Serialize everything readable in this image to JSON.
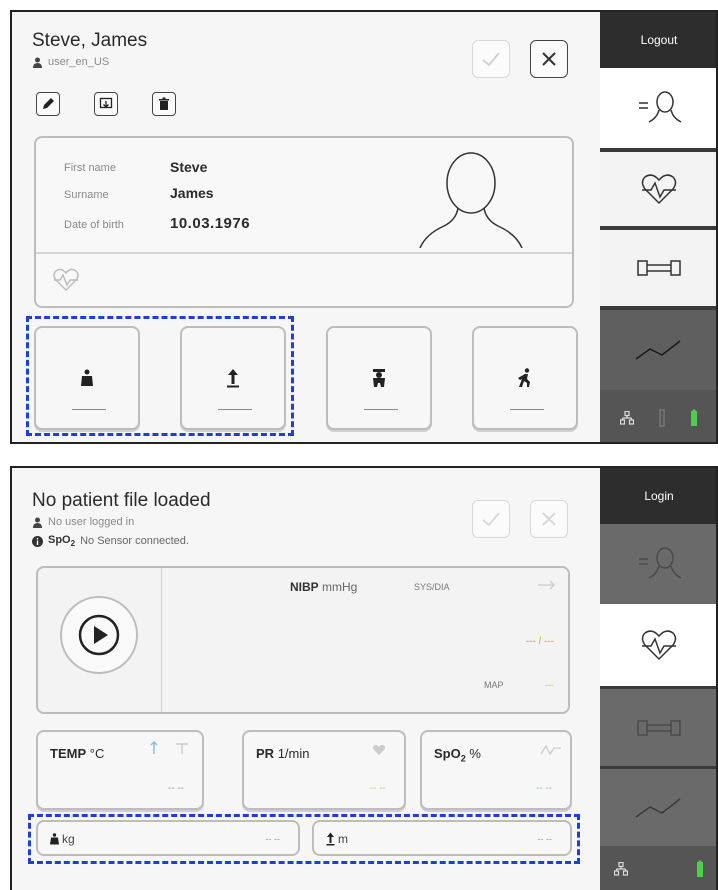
{
  "screen1": {
    "patient_name": "Steve, James",
    "user_id": "user_en_US",
    "fields": [
      {
        "label": "First name",
        "value": "Steve"
      },
      {
        "label": "Surname",
        "value": "James"
      },
      {
        "label": "Date of birth",
        "value": "10.03.1976"
      }
    ],
    "tiles": [
      {
        "icon": "weight-icon",
        "value": "—"
      },
      {
        "icon": "height-icon",
        "value": "—"
      },
      {
        "icon": "patient-status-icon",
        "value": "—"
      },
      {
        "icon": "activity-icon",
        "value": "—"
      }
    ],
    "sidebar": {
      "logout_label": "Logout",
      "items": [
        "patient-list-icon",
        "vital-signs-icon",
        "ecg-icon",
        "trend-icon"
      ],
      "status_icons": [
        "network-icon",
        "thermometer-icon",
        "battery-icon"
      ]
    }
  },
  "screen2": {
    "header": "No patient file loaded",
    "user_status": "No user logged in",
    "spo2_status_prefix": "SpO",
    "spo2_status_sub": "2",
    "spo2_status_text": "No Sensor connected.",
    "nibp": {
      "label": "NIBP",
      "unit": "mmHg",
      "mode": "SYS/DIA",
      "value": "--- / ---",
      "map_label": "MAP",
      "map_value": "---"
    },
    "measurements": [
      {
        "name": "TEMP",
        "unit": "°C",
        "value": "-- --"
      },
      {
        "name": "PR",
        "unit": "1/min",
        "value": "-- --"
      },
      {
        "name": "SpO",
        "sub": "2",
        "unit": "%",
        "value": "-- --"
      }
    ],
    "body": [
      {
        "unit": "kg",
        "value": "-- --"
      },
      {
        "unit": "m",
        "value": "-- --"
      }
    ],
    "sidebar": {
      "login_label": "Login"
    }
  },
  "colors": {
    "highlight_border": "#1e3fd6",
    "sidebar_dark": "#2d2d2d",
    "nibp_value": "#d7c73a",
    "pr_value": "#bcd65a",
    "spo2_value": "#7cc0e8"
  }
}
